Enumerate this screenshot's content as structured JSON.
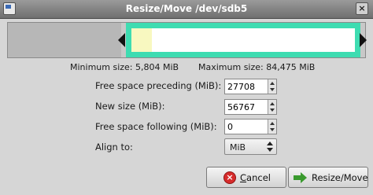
{
  "window": {
    "title": "Resize/Move /dev/sdb5",
    "close_glyph": "×"
  },
  "partition_graph": {
    "colors": {
      "border": "#3edcb1",
      "used": "#f8f8c0",
      "unallocated": "#b7b7b7"
    }
  },
  "sizes": {
    "minimum": "Minimum size: 5,804 MiB",
    "maximum": "Maximum size: 84,475 MiB"
  },
  "fields": {
    "free_preceding": {
      "label": "Free space preceding (MiB):",
      "value": "27708"
    },
    "new_size": {
      "label": "New size (MiB):",
      "value": "56767"
    },
    "free_following": {
      "label": "Free space following (MiB):",
      "value": "0"
    },
    "align_to": {
      "label": "Align to:",
      "value": "MiB"
    }
  },
  "buttons": {
    "cancel": {
      "label_first": "C",
      "label_rest": "ancel",
      "icon": "cancel-icon"
    },
    "resize": {
      "label": "Resize/Move",
      "icon": "resize-move-icon"
    }
  }
}
